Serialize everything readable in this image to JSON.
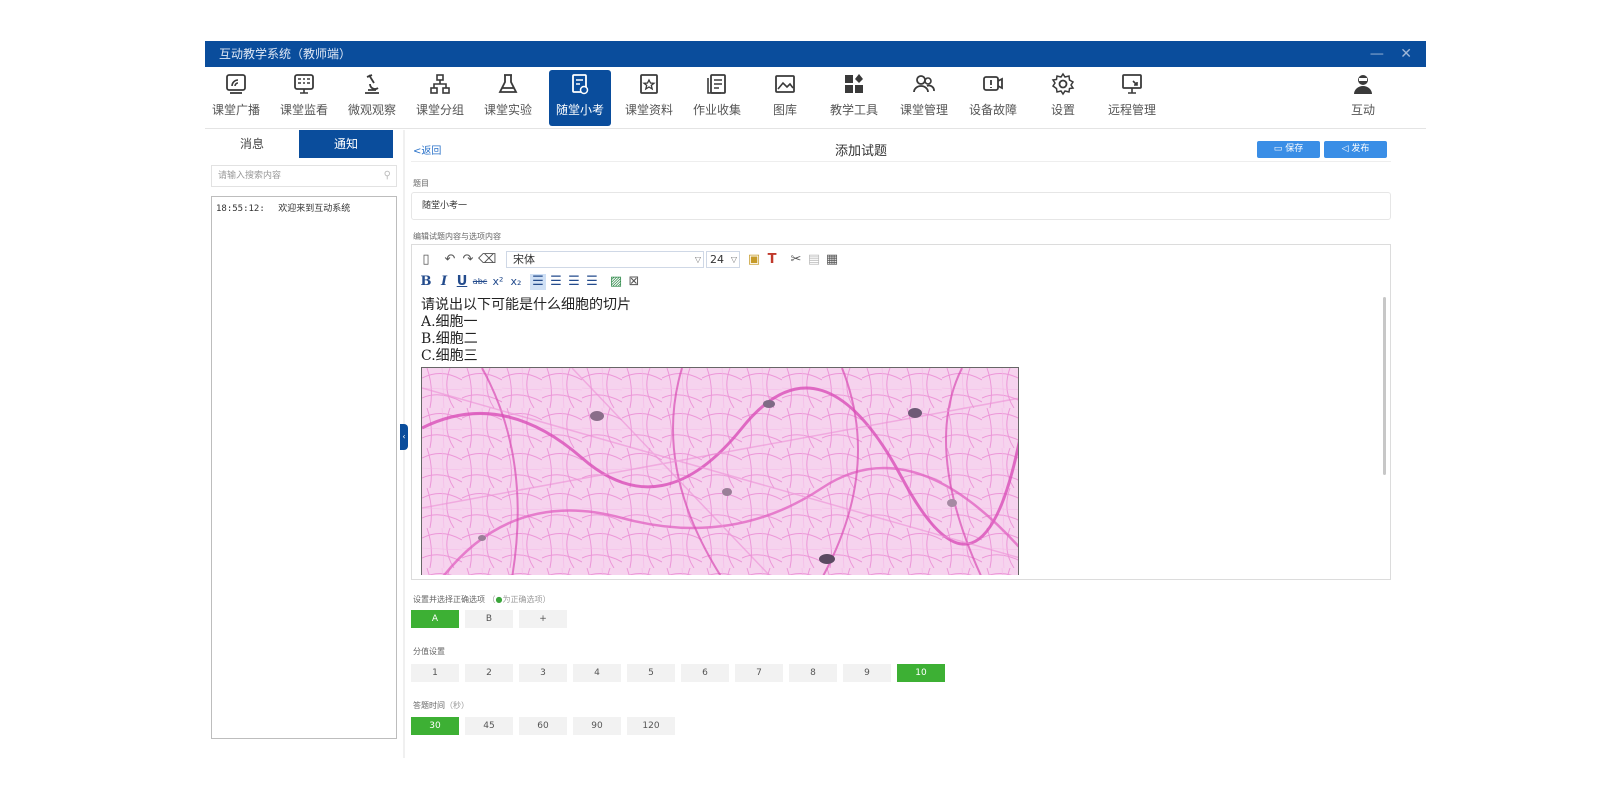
{
  "window": {
    "title": "互动教学系统（教师端）",
    "controls": "—  ✕"
  },
  "toolbar": {
    "items": [
      {
        "label": "课堂广播",
        "icon": "broadcast-icon"
      },
      {
        "label": "课堂监看",
        "icon": "monitor-grid-icon"
      },
      {
        "label": "微观观察",
        "icon": "microscope-icon"
      },
      {
        "label": "课堂分组",
        "icon": "group-tree-icon"
      },
      {
        "label": "课堂实验",
        "icon": "flask-icon"
      },
      {
        "label": "随堂小考",
        "icon": "quiz-icon"
      },
      {
        "label": "课堂资料",
        "icon": "materials-icon"
      },
      {
        "label": "作业收集",
        "icon": "homework-icon"
      },
      {
        "label": "图库",
        "icon": "gallery-icon"
      },
      {
        "label": "教学工具",
        "icon": "tools-icon"
      },
      {
        "label": "课堂管理",
        "icon": "users-icon"
      },
      {
        "label": "设备故障",
        "icon": "device-fault-icon"
      },
      {
        "label": "设置",
        "icon": "gear-icon"
      },
      {
        "label": "远程管理",
        "icon": "remote-icon"
      }
    ],
    "right_item": {
      "label": "互动",
      "icon": "teacher-avatar-icon"
    },
    "active_index": 5
  },
  "left": {
    "tabs": [
      "消息",
      "通知"
    ],
    "active_tab": "通知",
    "search_placeholder": "请输入搜索内容",
    "messages": [
      {
        "time": "18:55:12:",
        "text": "欢迎来到互动系统"
      }
    ]
  },
  "main": {
    "back_label": "返回",
    "page_title": "添加试题",
    "save_label": "保存",
    "publish_label": "发布",
    "title_field_label": "题目",
    "title_value": "随堂小考一",
    "editor_label": "编辑试题内容与选项内容",
    "editor": {
      "font": "宋体",
      "size": "24",
      "content_lines": [
        "请说出以下可能是什么细胞的切片",
        "A.细胞一",
        "B.细胞二",
        "C.细胞三"
      ]
    },
    "correct_label": "设置并选择正确选项",
    "correct_hint": "为正确选项",
    "options": [
      "A",
      "B",
      "+"
    ],
    "selected_option": "A",
    "score_label": "分值设置",
    "scores": [
      "1",
      "2",
      "3",
      "4",
      "5",
      "6",
      "7",
      "8",
      "9",
      "10"
    ],
    "selected_score": "10",
    "time_label": "答题时间",
    "time_unit": "（秒）",
    "times": [
      "30",
      "45",
      "60",
      "90",
      "120"
    ],
    "selected_time": "30"
  },
  "colors": {
    "brand": "#0a4d9c",
    "accent_green": "#3db034",
    "button_blue": "#3a8ee6"
  }
}
